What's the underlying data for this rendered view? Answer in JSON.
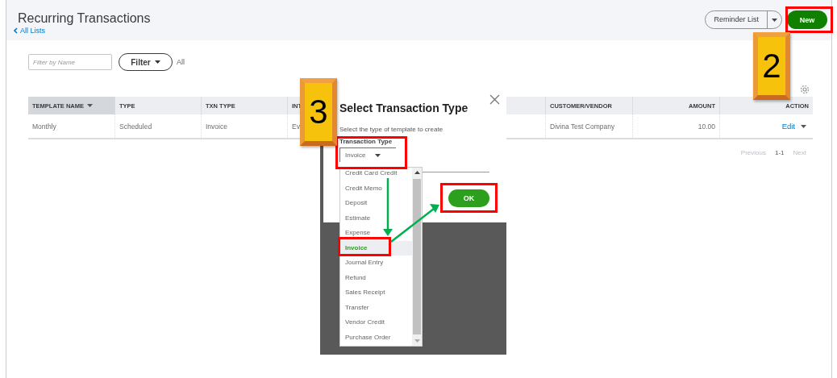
{
  "header": {
    "title": "Recurring Transactions",
    "back_link": "All Lists",
    "reminder_button": "Reminder List",
    "new_button": "New"
  },
  "filter": {
    "placeholder": "Filter by Name",
    "button": "Filter",
    "scope": "All"
  },
  "table": {
    "columns": [
      {
        "label": "TEMPLATE NAME",
        "sorted": true
      },
      {
        "label": "TYPE",
        "sorted": false
      },
      {
        "label": "TXN TYPE",
        "sorted": false
      },
      {
        "label": "INT",
        "sorted": false
      },
      {
        "label": "CUSTOMER/VENDOR",
        "sorted": false
      },
      {
        "label": "AMOUNT",
        "sorted": false
      },
      {
        "label": "ACTION",
        "sorted": false
      }
    ],
    "rows": [
      {
        "cells": [
          "Monthly",
          "Scheduled",
          "Invoice",
          "Ev",
          "Divina Test Company",
          "10.00"
        ],
        "action": "Edit"
      }
    ]
  },
  "pagination": {
    "previous": "Previous",
    "range": "1-1",
    "next": "Next"
  },
  "dialog": {
    "title": "Select Transaction Type",
    "description": "Select the type of template to create",
    "field_label": "Transaction Type",
    "select_value": "Invoice",
    "ok": "OK",
    "options": [
      {
        "label": "Credit Card Credit",
        "selected": false
      },
      {
        "label": "Credit Memo",
        "selected": false
      },
      {
        "label": "Deposit",
        "selected": false
      },
      {
        "label": "Estimate",
        "selected": false
      },
      {
        "label": "Expense",
        "selected": false
      },
      {
        "label": "Invoice",
        "selected": true
      },
      {
        "label": "Journal Entry",
        "selected": false
      },
      {
        "label": "Refund",
        "selected": false
      },
      {
        "label": "Sales Receipt",
        "selected": false
      },
      {
        "label": "Transfer",
        "selected": false
      },
      {
        "label": "Vendor Credit",
        "selected": false
      },
      {
        "label": "Purchase Order",
        "selected": false
      }
    ]
  },
  "step_badges": [
    {
      "number": "2"
    },
    {
      "number": "3"
    }
  ]
}
